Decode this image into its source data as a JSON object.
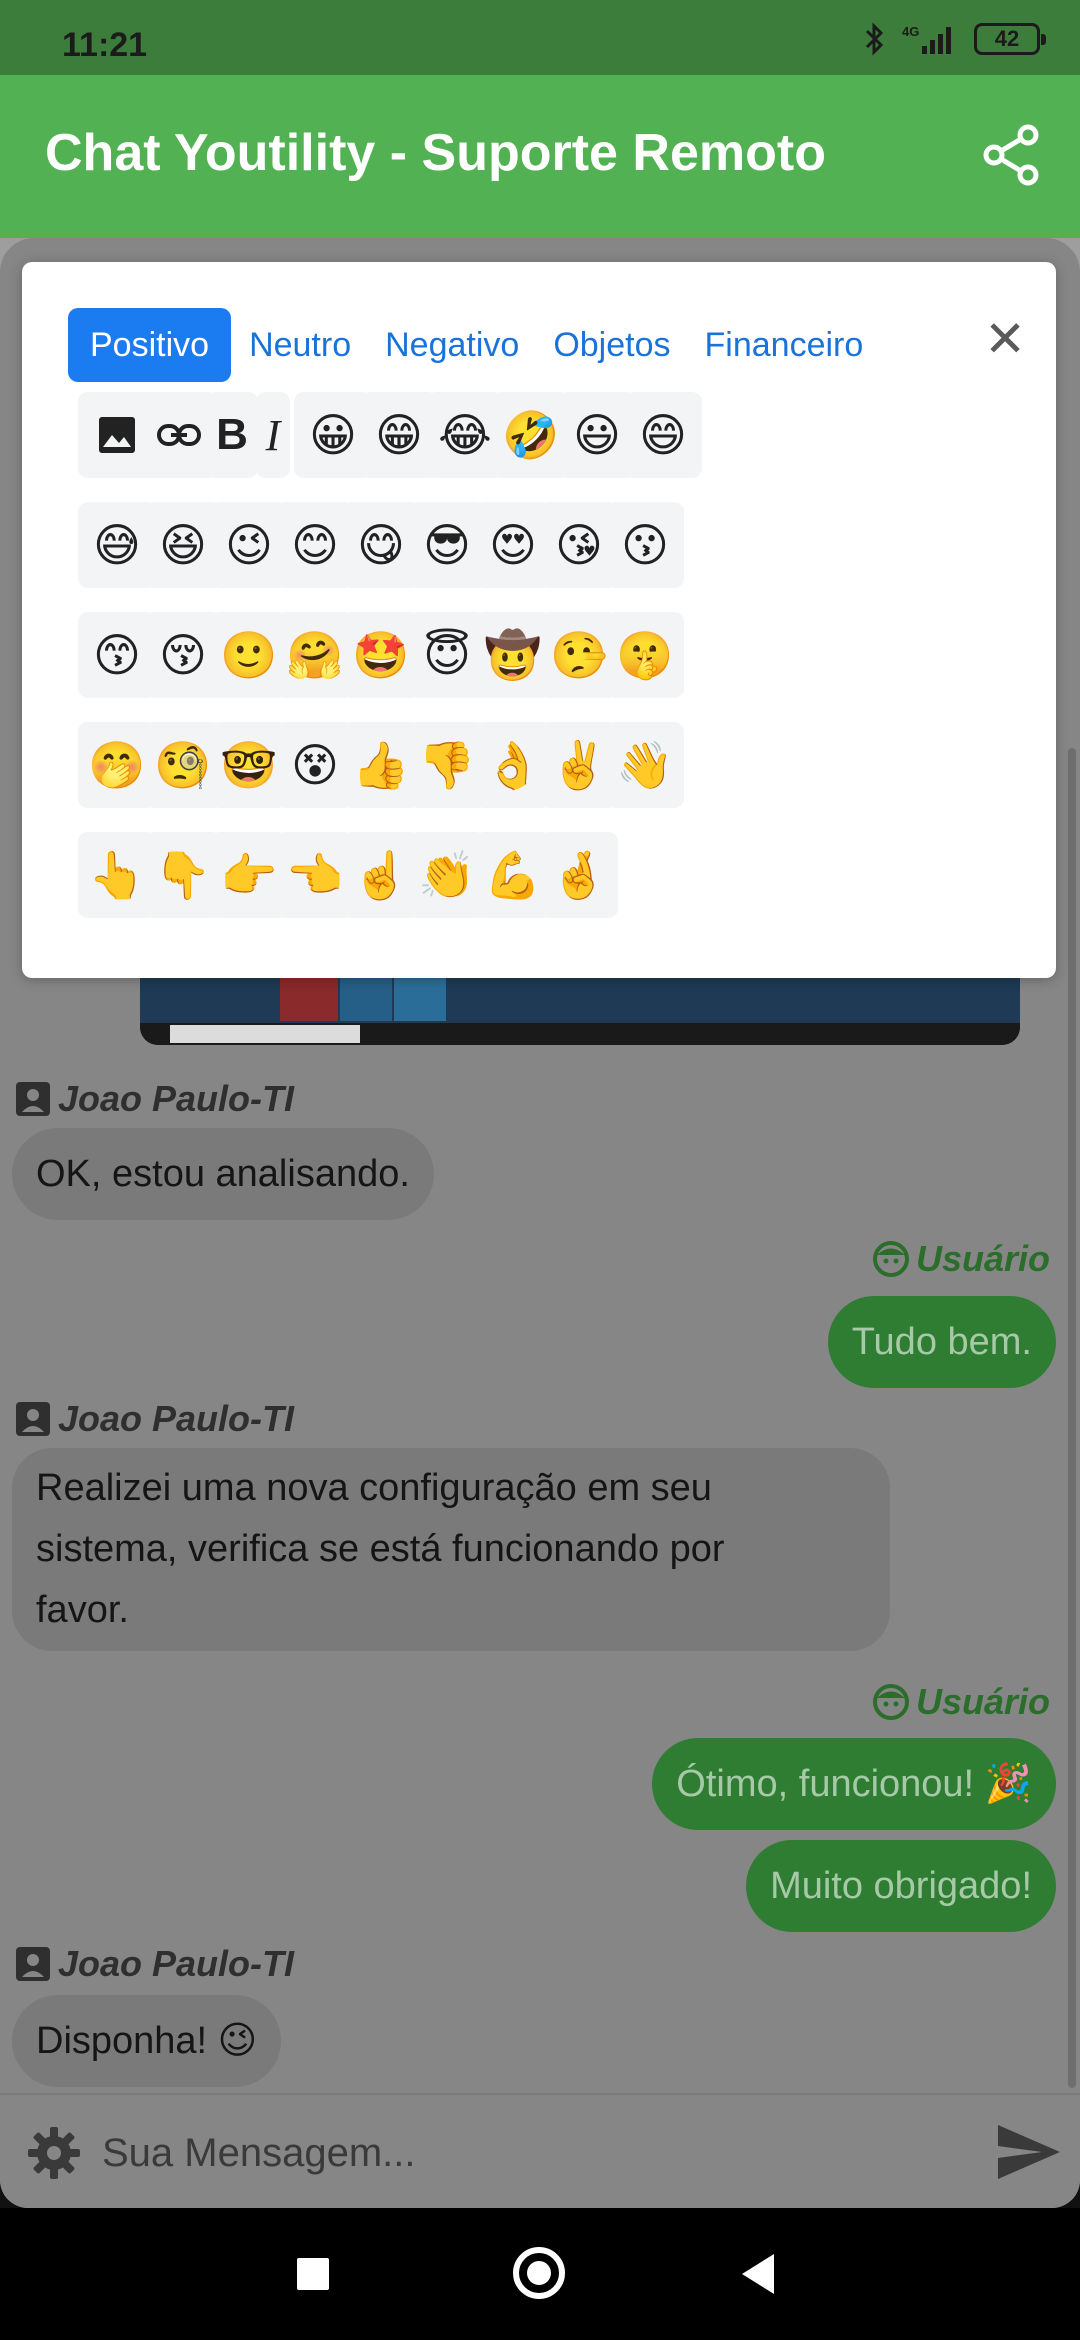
{
  "status_bar": {
    "time": "11:21",
    "network": "4G",
    "battery": "42"
  },
  "app_bar": {
    "title": "Chat Youtility - Suporte Remoto",
    "share_icon": "share-icon"
  },
  "emoji_picker": {
    "tabs": [
      {
        "label": "Positivo",
        "active": true
      },
      {
        "label": "Neutro",
        "active": false
      },
      {
        "label": "Negativo",
        "active": false
      },
      {
        "label": "Objetos",
        "active": false
      },
      {
        "label": "Financeiro",
        "active": false
      }
    ],
    "close_label": "✕",
    "format_tools": {
      "image_icon": "image-icon",
      "link_icon": "link-icon",
      "bold": "B",
      "italic": "I"
    },
    "emojis": [
      "😀",
      "😁",
      "😂",
      "🤣",
      "😃",
      "😄",
      "😅",
      "😆",
      "😉",
      "😊",
      "😋",
      "😎",
      "😍",
      "😘",
      "😗",
      "😙",
      "😚",
      "🙂",
      "🤗",
      "🤩",
      "😇",
      "🤠",
      "🤥",
      "🤫",
      "🤭",
      "🧐",
      "🤓",
      "😵",
      "👍",
      "👎",
      "👌",
      "✌️",
      "👋",
      "👆",
      "👇",
      "👉",
      "👈",
      "☝️",
      "👏",
      "💪",
      "🤞"
    ]
  },
  "chat": {
    "messages": [
      {
        "id": "m1",
        "from": "agent",
        "author": "Joao Paulo-TI",
        "text": "OK, estou analisando."
      },
      {
        "id": "m2",
        "from": "user",
        "author": "Usuário",
        "text": "Tudo bem."
      },
      {
        "id": "m3",
        "from": "agent",
        "author": "Joao Paulo-TI",
        "lines": [
          "Realizei uma nova configuração em seu",
          "sistema, verifica se está funcionando por",
          "favor."
        ]
      },
      {
        "id": "m4",
        "from": "user",
        "author": "Usuário",
        "text": "Ótimo, funcionou! 🎉"
      },
      {
        "id": "m5",
        "from": "user",
        "author": "",
        "text": "Muito obrigado!"
      },
      {
        "id": "m6",
        "from": "agent",
        "author": "Joao Paulo-TI",
        "text": "Disponha! 😉"
      }
    ]
  },
  "composer": {
    "placeholder": "Sua Mensagem...",
    "settings_icon": "gear-icon",
    "send_icon": "send-icon"
  },
  "colors": {
    "app_bar": "#52b152",
    "status_bar": "#3c7d3c",
    "tab_active": "#1a7cf0",
    "user_bubble": "#2e7d32"
  }
}
